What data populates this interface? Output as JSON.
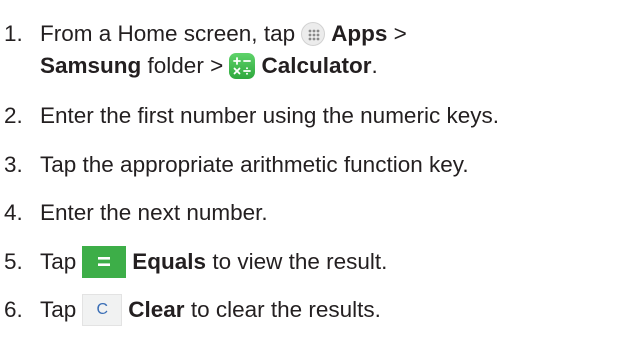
{
  "steps": [
    {
      "number": "1.",
      "line1": {
        "text_a": "From a Home screen, tap",
        "apps_icon": "apps-grid-icon",
        "apps_label": "Apps",
        "text_b": " >"
      },
      "line2": {
        "samsung_label": "Samsung",
        "text_c": " folder > ",
        "calc_icon": "calculator-app-icon",
        "calc_label": "Calculator",
        "text_d": "."
      }
    },
    {
      "number": "2.",
      "text": "Enter the first number using the numeric keys."
    },
    {
      "number": "3.",
      "text": "Tap the appropriate arithmetic function key."
    },
    {
      "number": "4.",
      "text": "Enter the next number."
    },
    {
      "number": "5.",
      "text_a": "Tap",
      "icon": "equals-key-icon",
      "icon_glyph": "=",
      "label": "Equals",
      "text_b": " to view the result."
    },
    {
      "number": "6.",
      "text_a": "Tap",
      "icon": "clear-key-icon",
      "icon_glyph": "C",
      "label": "Clear",
      "text_b": " to clear the results."
    }
  ],
  "colors": {
    "text": "#231f20",
    "equals_key": "#3dae48",
    "clear_key_bg": "#f1f2f2",
    "clear_key_glyph": "#3b6fb6",
    "calculator_icon": "#3fbf4f"
  }
}
